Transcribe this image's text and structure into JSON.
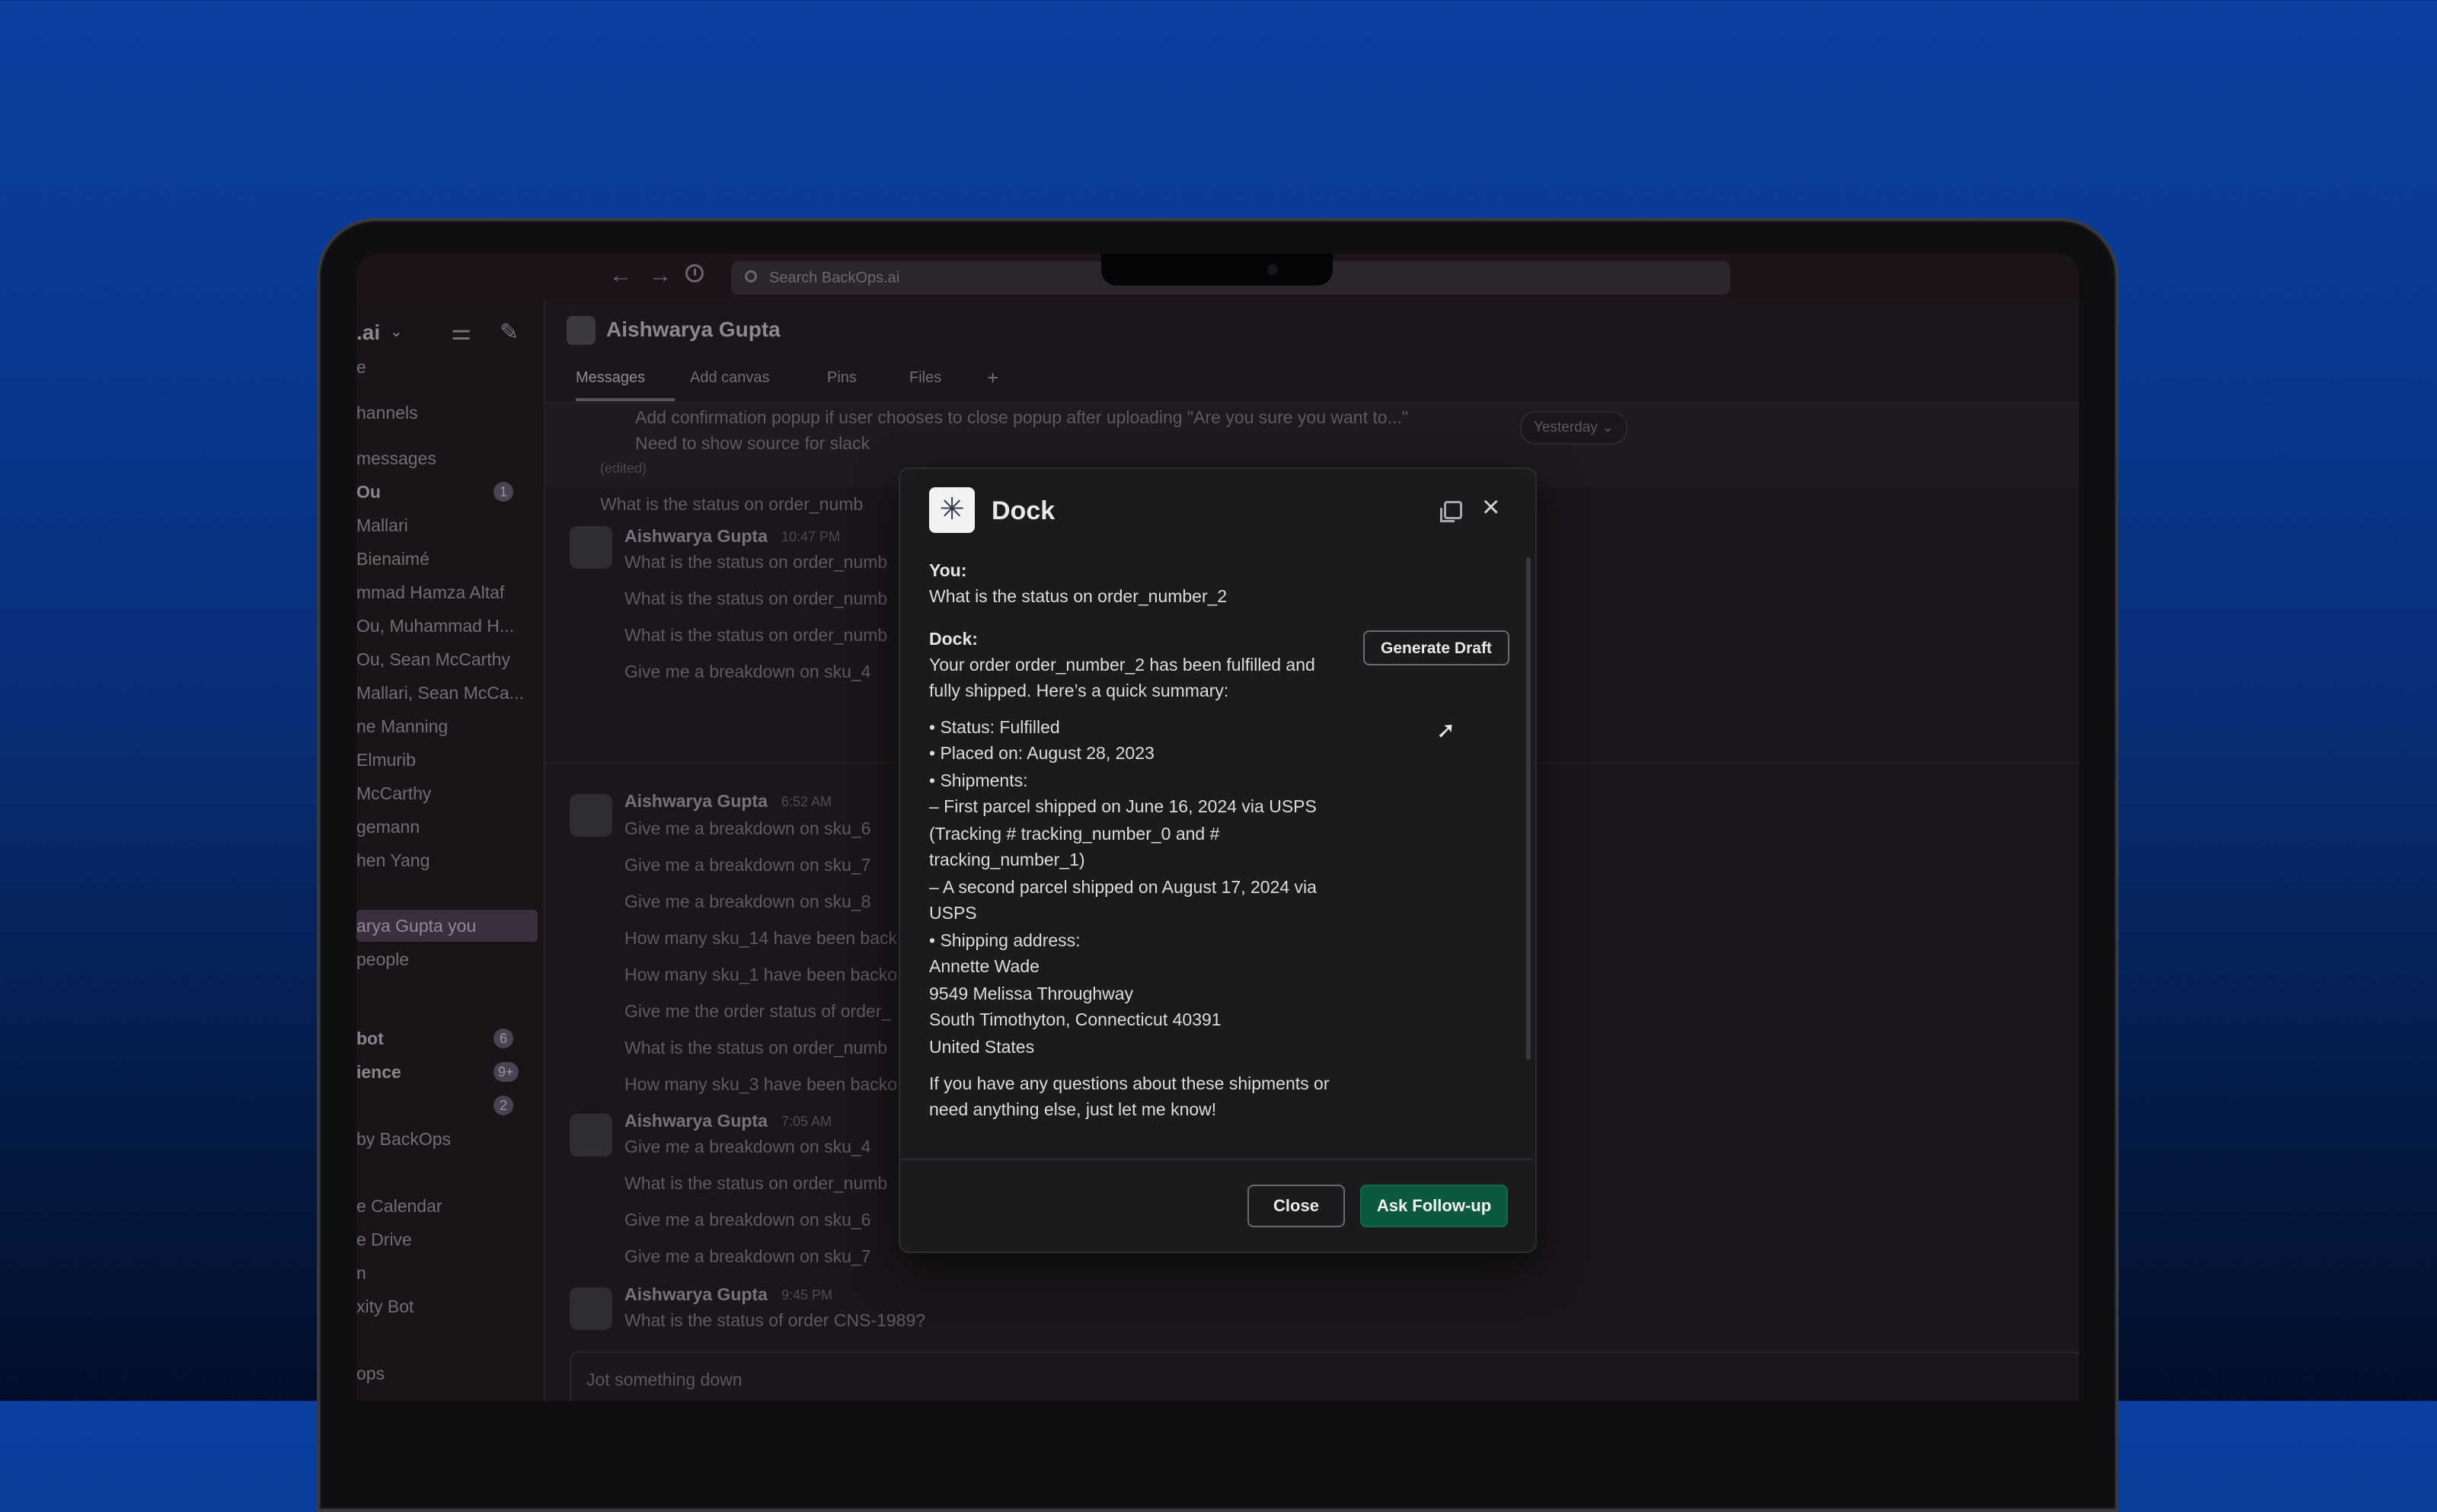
{
  "topbar": {
    "back_icon": "←",
    "forward_icon": "→",
    "search_placeholder": "Search BackOps.ai"
  },
  "sidebar": {
    "workspace": ".ai",
    "items": [
      {
        "label": "e"
      },
      {
        "label": "hannels"
      },
      {
        "label": "messages"
      },
      {
        "label": "Ou",
        "badge": "1",
        "bold": true
      },
      {
        "label": "Mallari"
      },
      {
        "label": "Bienaimé"
      },
      {
        "label": "mmad Hamza Altaf"
      },
      {
        "label": "Ou, Muhammad H..."
      },
      {
        "label": "Ou, Sean McCarthy"
      },
      {
        "label": "Mallari, Sean McCa..."
      },
      {
        "label": "ne Manning"
      },
      {
        "label": "Elmurib"
      },
      {
        "label": "McCarthy"
      },
      {
        "label": "gemann"
      },
      {
        "label": "hen Yang"
      },
      {
        "label": "arya Gupta  you",
        "selected": true
      },
      {
        "label": "people"
      },
      {
        "label": "bot",
        "badge": "6",
        "bold": true
      },
      {
        "label": "ience",
        "badge": "9+",
        "bold": true
      },
      {
        "label": "",
        "badge": "2"
      },
      {
        "label": "by BackOps"
      },
      {
        "label": "e Calendar"
      },
      {
        "label": "e Drive"
      },
      {
        "label": "n"
      },
      {
        "label": "xity Bot"
      },
      {
        "label": "ops"
      }
    ]
  },
  "channel": {
    "title": "Aishwarya Gupta",
    "tabs": [
      "Messages",
      "Add canvas",
      "Pins",
      "Files",
      "+"
    ],
    "date_chip": "Yesterday ⌄",
    "composer_placeholder": "Jot something down"
  },
  "messages": {
    "bullet_1": "Add confirmation popup if user chooses to close popup after uploading \"Are you sure you want to...\"",
    "bullet_2": "Need to show source for slack",
    "edited": "(edited)",
    "m1": "What is the status on order_numb",
    "g1_author": "Aishwarya Gupta",
    "g1_time": "10:47 PM",
    "g1_l1": "What is the status on order_numb",
    "g1_l2": "What is the status on order_numb",
    "g1_l3": "What is the status on order_numb",
    "g1_l4": "Give me a breakdown on sku_4",
    "g2_author": "Aishwarya Gupta",
    "g2_time": "6:52 AM",
    "g2_l1": "Give me a breakdown on sku_6",
    "g2_l2": "Give me a breakdown on sku_7",
    "g2_l3": "Give me a breakdown on sku_8",
    "g2_l4": "How many sku_14 have been back",
    "g2_l5": "How many sku_1 have been backo",
    "g2_l6": "Give me the order status of order_",
    "g2_l7": "What is the status on order_numb",
    "g2_l8": "How many sku_3 have been backo",
    "g3_author": "Aishwarya Gupta",
    "g3_time": "7:05 AM",
    "g3_l1": "Give me a breakdown on sku_4",
    "g3_l2": "What is the status on order_numb",
    "g3_l3": "Give me a breakdown on sku_6",
    "g3_l4": "Give me a breakdown on sku_7",
    "g4_author": "Aishwarya Gupta",
    "g4_time": "9:45 PM",
    "g4_l1": "What is the status of order CNS-1989?"
  },
  "modal": {
    "title": "Dock",
    "you_label": "You:",
    "you_text": "What is the status on order_number_2",
    "dock_label": "Dock:",
    "generate_draft": "Generate Draft",
    "lines": [
      "Your order order_number_2 has been fulfilled and",
      "fully shipped. Here’s a quick summary:",
      "• Status: Fulfilled",
      "• Placed on: August 28, 2023",
      "• Shipments:",
      "  – First parcel shipped on June 16, 2024 via USPS",
      "(Tracking # tracking_number_0 and #",
      "tracking_number_1)",
      "  – A second parcel shipped on August 17, 2024 via",
      "USPS",
      "• Shipping address:",
      " Annette Wade",
      " 9549 Melissa Throughway",
      " South Timothyton, Connecticut 40391",
      " United States",
      "If you have any questions about these shipments or",
      "need anything else, just let me know!"
    ],
    "close_label": "Close",
    "follow_up_label": "Ask Follow-up"
  }
}
